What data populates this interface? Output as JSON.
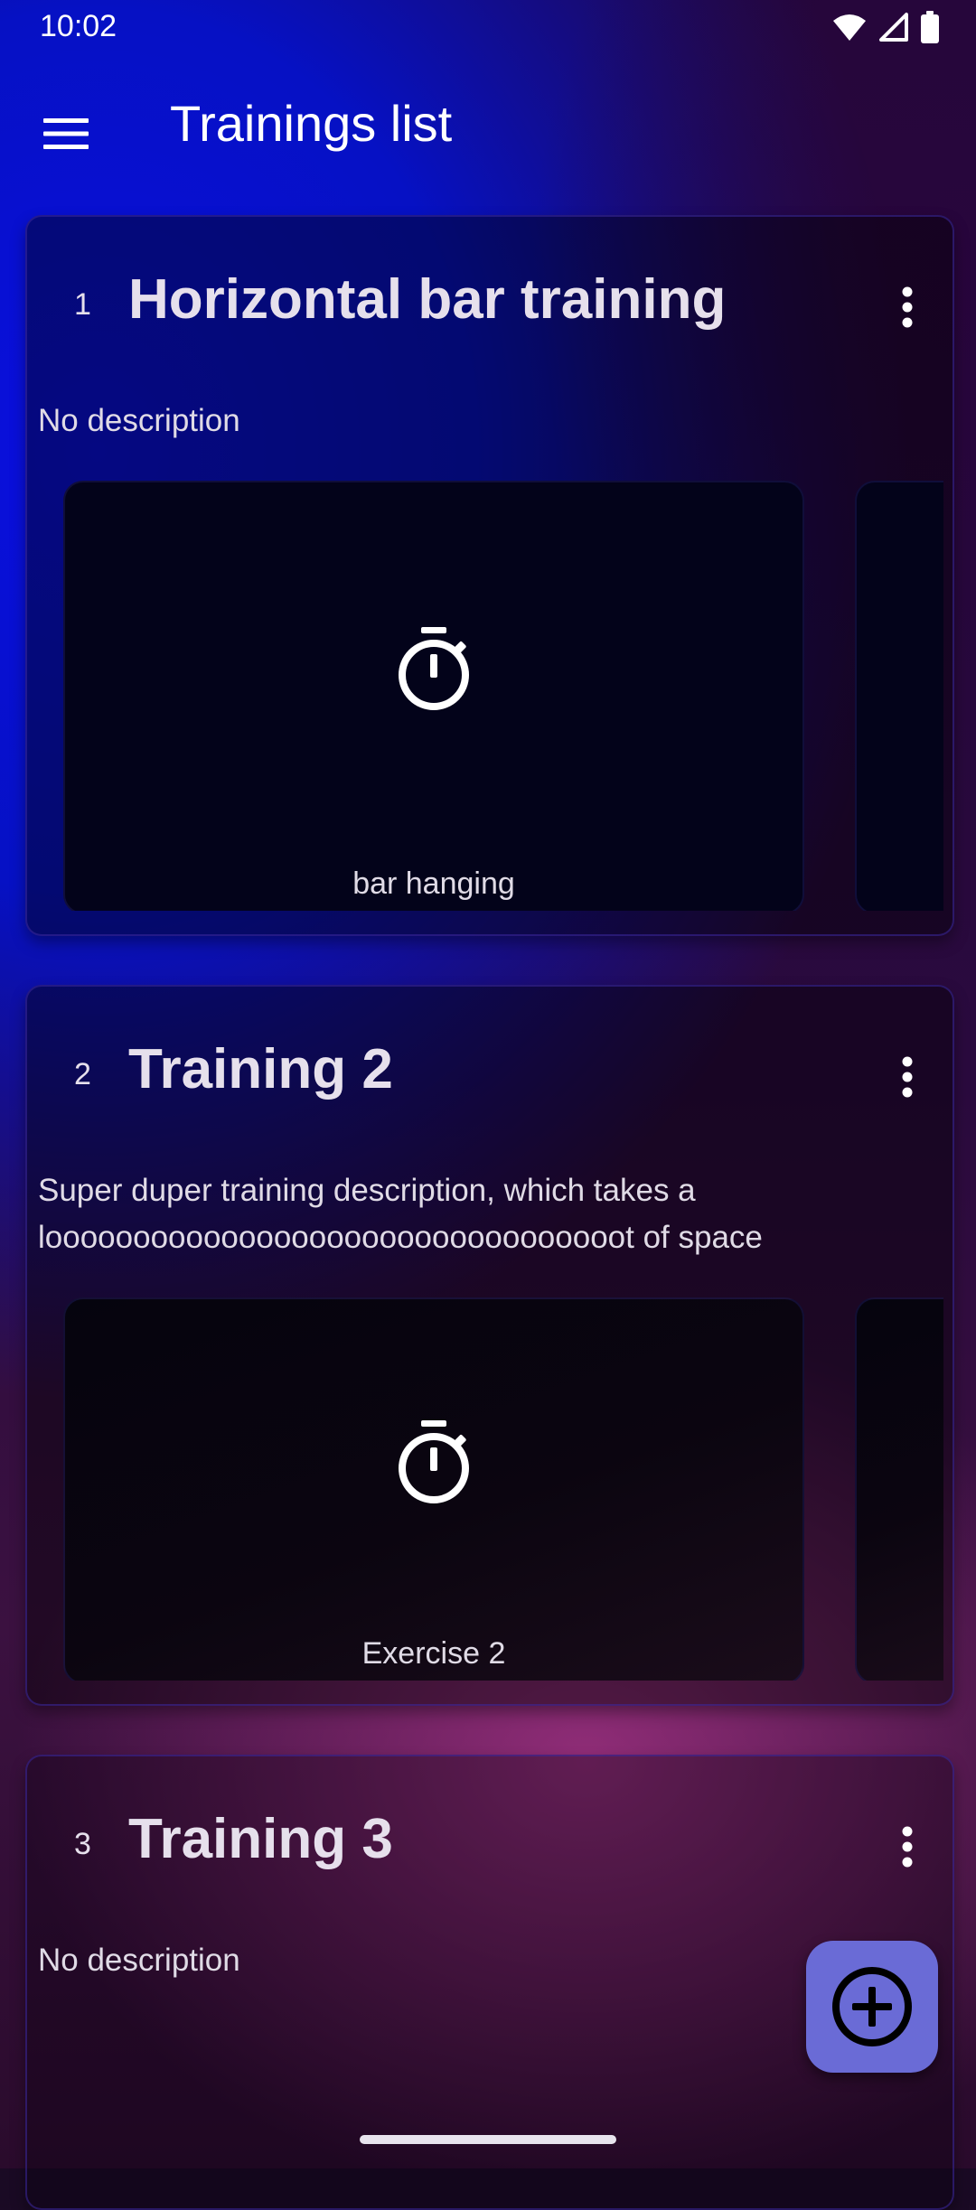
{
  "status_bar": {
    "time": "10:02",
    "icons": [
      "wifi-icon",
      "signal-icon",
      "battery-icon"
    ]
  },
  "app_bar": {
    "title": "Trainings list",
    "menu_icon": "menu-icon"
  },
  "trainings": [
    {
      "number": "1",
      "title": "Horizontal bar training",
      "description": "No description",
      "exercises": [
        {
          "name": "bar hanging",
          "icon": "timer-icon"
        }
      ]
    },
    {
      "number": "2",
      "title": "Training 2",
      "description": "Super duper training description, which takes a looooooooooooooooooooooooooooooooot of space",
      "exercises": [
        {
          "name": "Exercise 2",
          "icon": "timer-icon"
        }
      ]
    },
    {
      "number": "3",
      "title": "Training 3",
      "description": "No description",
      "exercises": []
    }
  ],
  "fab": {
    "icon": "add-circle-icon"
  },
  "colors": {
    "accent_blue": "#0a0fe0",
    "fab": "#6a6bd6",
    "text": "#e6e0ec"
  }
}
